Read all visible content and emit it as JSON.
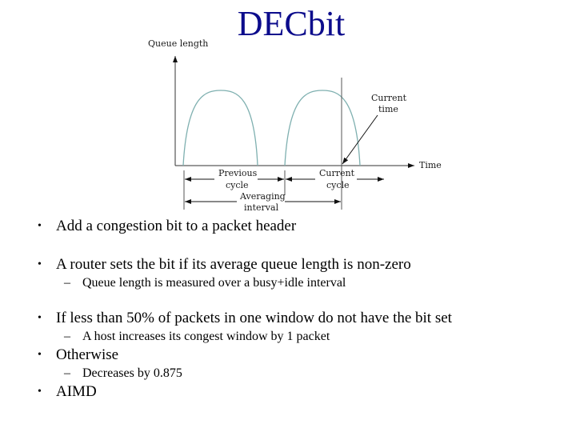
{
  "slide": {
    "title": "DECbit",
    "accent_color": "#0c0c8c"
  },
  "diagram": {
    "y_axis_label": "Queue length",
    "x_axis_label": "Time",
    "current_time_label_line1": "Current",
    "current_time_label_line2": "time",
    "previous_cycle_line1": "Previous",
    "previous_cycle_line2": "cycle",
    "current_cycle_line1": "Current",
    "current_cycle_line2": "cycle",
    "averaging_line1": "Averaging",
    "averaging_line2": "interval",
    "curve_color": "#7fb0b0"
  },
  "bullets": [
    {
      "marker": "•",
      "text": "Add a congestion bit to a packet header"
    },
    {
      "marker": "•",
      "text": "A router sets the bit if its average queue length is non-zero"
    },
    {
      "marker": "–",
      "text": "Queue length is measured over a busy+idle interval"
    },
    {
      "marker": "•",
      "text": "If less than 50% of packets in one window do not have the bit set"
    },
    {
      "marker": "–",
      "text": "A host increases its congest window by 1 packet"
    },
    {
      "marker": "•",
      "text": "Otherwise"
    },
    {
      "marker": "–",
      "text": "Decreases by 0.875"
    },
    {
      "marker": "•",
      "text": "AIMD"
    }
  ]
}
